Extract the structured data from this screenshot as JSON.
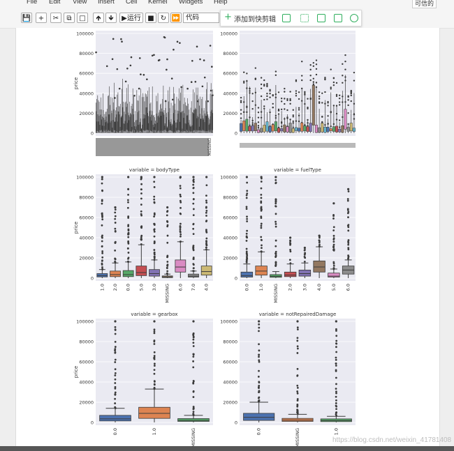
{
  "menu": {
    "items": [
      "File",
      "Edit",
      "View",
      "Insert",
      "Cell",
      "Kernel",
      "Widgets",
      "Help"
    ],
    "trusted_label": "可信的"
  },
  "toolbar": {
    "run_label": "运行",
    "cell_type": "代码"
  },
  "clip_popup": {
    "label": "添加到快剪辑"
  },
  "watermark": "https://blog.csdn.net/weixin_41781408",
  "chart_data": [
    {
      "type": "box",
      "title": "",
      "xlabel": "",
      "ylabel": "price",
      "ylim": [
        0,
        100000
      ],
      "yticks": [
        0,
        20000,
        40000,
        60000,
        80000,
        100000
      ],
      "categories": "many dense unreadable category labels (last: MISSING)",
      "last_category": "MISSING",
      "note": "dense boxplots, all dark grey"
    },
    {
      "type": "box",
      "title": "",
      "xlabel": "",
      "ylabel": "",
      "ylim": [
        0,
        100000
      ],
      "yticks": [
        0,
        20000,
        40000,
        60000,
        80000,
        100000
      ],
      "categories": "about 40 small unreadable category labels",
      "note": "colored boxplots"
    },
    {
      "type": "box",
      "title": "variable = bodyType",
      "ylabel": "price",
      "ylim": [
        0,
        100000
      ],
      "yticks": [
        0,
        20000,
        40000,
        60000,
        80000,
        100000
      ],
      "categories": [
        "1.0",
        "2.0",
        "0.0",
        "5.0",
        "3.0",
        "MISSING",
        "6.0",
        "7.0",
        "4.0"
      ],
      "boxes": [
        {
          "q1": 1200,
          "median": 2500,
          "q3": 4500,
          "whisker_high": 8500,
          "outlier_max": 100000,
          "color": "#4c72b0"
        },
        {
          "q1": 1500,
          "median": 3500,
          "q3": 7000,
          "whisker_high": 15000,
          "outlier_max": 70000,
          "color": "#dd8452"
        },
        {
          "q1": 1500,
          "median": 3500,
          "q3": 7500,
          "whisker_high": 16000,
          "outlier_max": 100000,
          "color": "#55a868"
        },
        {
          "q1": 2500,
          "median": 5500,
          "q3": 12000,
          "whisker_high": 33000,
          "outlier_max": 100000,
          "color": "#c44e52"
        },
        {
          "q1": 2000,
          "median": 4500,
          "q3": 8500,
          "whisker_high": 18000,
          "outlier_max": 100000,
          "color": "#8172b3"
        },
        {
          "q1": 500,
          "median": 1200,
          "q3": 2200,
          "whisker_high": 4000,
          "outlier_max": 70000,
          "color": "#937860"
        },
        {
          "q1": 6000,
          "median": 11000,
          "q3": 18000,
          "whisker_high": 36000,
          "outlier_max": 100000,
          "color": "#da8bc3"
        },
        {
          "q1": 1000,
          "median": 2000,
          "q3": 4000,
          "whisker_high": 7000,
          "outlier_max": 100000,
          "color": "#8c8c8c"
        },
        {
          "q1": 3000,
          "median": 6500,
          "q3": 12000,
          "whisker_high": 28000,
          "outlier_max": 100000,
          "color": "#ccb974"
        }
      ]
    },
    {
      "type": "box",
      "title": "variable = fuelType",
      "ylabel": "",
      "ylim": [
        0,
        100000
      ],
      "yticks": [
        0,
        20000,
        40000,
        60000,
        80000,
        100000
      ],
      "categories": [
        "0.0",
        "1.0",
        "MISSING",
        "2.0",
        "3.0",
        "4.0",
        "5.0",
        "6.0"
      ],
      "boxes": [
        {
          "q1": 1000,
          "median": 2500,
          "q3": 6000,
          "whisker_high": 14000,
          "outlier_max": 100000,
          "color": "#4c72b0"
        },
        {
          "q1": 3000,
          "median": 7000,
          "q3": 12000,
          "whisker_high": 26000,
          "outlier_max": 100000,
          "color": "#dd8452"
        },
        {
          "q1": 800,
          "median": 1800,
          "q3": 3500,
          "whisker_high": 6500,
          "outlier_max": 100000,
          "color": "#55a868"
        },
        {
          "q1": 1500,
          "median": 3000,
          "q3": 6000,
          "whisker_high": 14000,
          "outlier_max": 40000,
          "color": "#c44e52"
        },
        {
          "q1": 2000,
          "median": 4500,
          "q3": 8000,
          "whisker_high": 15000,
          "outlier_max": 30000,
          "color": "#8172b3"
        },
        {
          "q1": 6000,
          "median": 11000,
          "q3": 17000,
          "whisker_high": 31000,
          "outlier_max": 42000,
          "color": "#937860"
        },
        {
          "q1": 1000,
          "median": 2000,
          "q3": 5000,
          "whisker_high": 9000,
          "outlier_max": 74000,
          "color": "#da8bc3"
        },
        {
          "q1": 4000,
          "median": 8000,
          "q3": 12000,
          "whisker_high": 18000,
          "outlier_max": 88000,
          "color": "#8c8c8c"
        }
      ]
    },
    {
      "type": "box",
      "title": "variable = gearbox",
      "ylabel": "price",
      "ylim": [
        0,
        100000
      ],
      "yticks": [
        0,
        20000,
        40000,
        60000,
        80000,
        100000
      ],
      "categories": [
        "0.0",
        "1.0",
        "MISSING"
      ],
      "boxes": [
        {
          "q1": 1500,
          "median": 3500,
          "q3": 7000,
          "whisker_high": 14000,
          "outlier_max": 100000,
          "color": "#4c72b0"
        },
        {
          "q1": 4000,
          "median": 9000,
          "q3": 15000,
          "whisker_high": 33000,
          "outlier_max": 100000,
          "color": "#dd8452"
        },
        {
          "q1": 1000,
          "median": 2000,
          "q3": 3800,
          "whisker_high": 7000,
          "outlier_max": 100000,
          "color": "#55a868"
        }
      ]
    },
    {
      "type": "box",
      "title": "variable = notRepairedDamage",
      "ylabel": "",
      "ylim": [
        0,
        100000
      ],
      "yticks": [
        0,
        20000,
        40000,
        60000,
        80000,
        100000
      ],
      "categories": [
        "0.0",
        "MISSING",
        "1.0"
      ],
      "boxes": [
        {
          "q1": 2000,
          "median": 5000,
          "q3": 9000,
          "whisker_high": 20000,
          "outlier_max": 100000,
          "color": "#4c72b0"
        },
        {
          "q1": 1000,
          "median": 2200,
          "q3": 4000,
          "whisker_high": 8000,
          "outlier_max": 100000,
          "color": "#dd8452"
        },
        {
          "q1": 800,
          "median": 1800,
          "q3": 3500,
          "whisker_high": 6000,
          "outlier_max": 100000,
          "color": "#55a868"
        }
      ]
    }
  ]
}
